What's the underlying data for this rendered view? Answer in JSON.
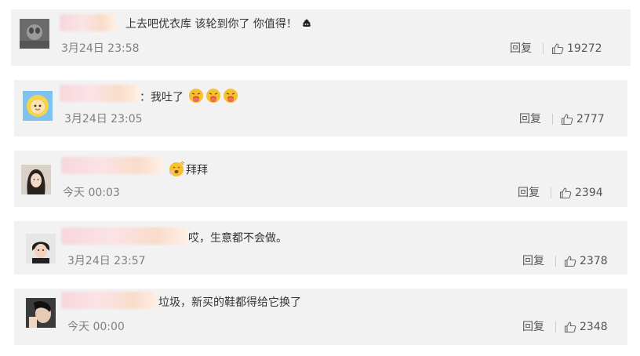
{
  "comments": [
    {
      "text": "上去吧优衣库 该轮到你了 你值得！",
      "time": "3月24日 23:58",
      "reply_label": "回复",
      "likes": "19272",
      "emoji": [
        "poop-icon"
      ]
    },
    {
      "text": "：我吐了",
      "time": "3月24日 23:05",
      "reply_label": "回复",
      "likes": "2777",
      "emoji": [
        "vomit-face-icon",
        "vomit-face-icon",
        "vomit-face-icon"
      ]
    },
    {
      "text": "拜拜",
      "time": "今天 00:03",
      "reply_label": "回复",
      "likes": "2394",
      "emoji": [
        "wave-face-icon"
      ]
    },
    {
      "text": "哎，生意都不会做。",
      "time": "3月24日 23:57",
      "reply_label": "回复",
      "likes": "2378",
      "emoji": []
    },
    {
      "text": "垃圾，新买的鞋都得给它换了",
      "time": "今天 00:00",
      "reply_label": "回复",
      "likes": "2348",
      "emoji": []
    }
  ],
  "colors": {
    "card_bg": "#f2f2f2",
    "text": "#333333",
    "time": "#808080",
    "emoji_yellow": "#f5c12e"
  }
}
